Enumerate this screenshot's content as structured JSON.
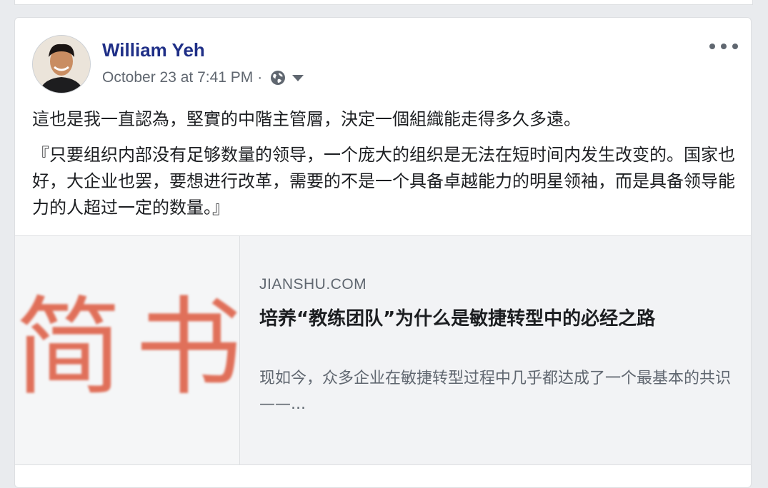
{
  "post": {
    "author": "William Yeh",
    "timestamp": "October 23 at 7:41 PM",
    "separator": "·",
    "privacy_icon": "globe-icon",
    "menu_icon": "more-options-icon",
    "text_line1": "這也是我一直認為，堅實的中階主管層，決定一個組織能走得多久多遠。",
    "text_quote": "『只要组织内部没有足够数量的领导，一个庞大的组织是无法在短时间内发生改变的。国家也好，大企业也罢，要想进行改革，需要的不是一个具备卓越能力的明星领袖，而是具备领导能力的人超过一定的数量。』"
  },
  "link_preview": {
    "thumbnail_text": "简书",
    "domain": "JIANSHU.COM",
    "title": "培养“教练团队”为什么是敏捷转型中的必经之路",
    "description": "现如今，众多企业在敏捷转型过程中几乎都达成了一个最基本的共识 ——..."
  },
  "colors": {
    "author": "#1f2f87",
    "meta": "#606770",
    "logo": "#e0705a",
    "card_bg": "#f2f3f5"
  }
}
